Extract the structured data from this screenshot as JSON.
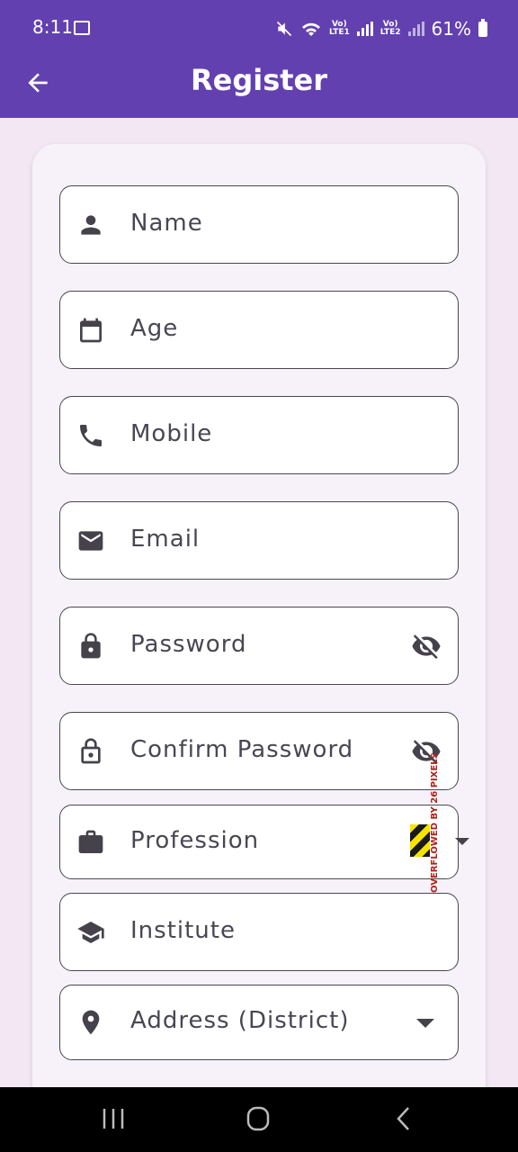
{
  "status_bar": {
    "time": "8:11",
    "network_1": "Vo)\nLTE1",
    "network_2": "Vo)\nLTE2",
    "battery_percent": "61%"
  },
  "app_bar": {
    "title": "Register"
  },
  "form": {
    "fields": [
      {
        "label": "Name",
        "icon": "person-icon"
      },
      {
        "label": "Age",
        "icon": "calendar-icon"
      },
      {
        "label": "Mobile",
        "icon": "phone-icon"
      },
      {
        "label": "Email",
        "icon": "email-icon"
      },
      {
        "label": "Password",
        "icon": "lock-icon",
        "trailing": "visibility-off-icon"
      },
      {
        "label": "Confirm Password",
        "icon": "lock-open-icon",
        "trailing": "visibility-off-icon"
      },
      {
        "label": "Profession",
        "icon": "briefcase-icon",
        "trailing": "dropdown-arrow-icon"
      },
      {
        "label": "Institute",
        "icon": "school-icon"
      },
      {
        "label": "Address (District)",
        "icon": "location-pin-icon",
        "trailing": "dropdown-arrow-icon"
      }
    ],
    "overflow_warning": "OVERFLOWED BY 26 PIXELS"
  },
  "colors": {
    "primary": "#6340b0",
    "background": "#f2e7f3",
    "card": "#f7f2f9",
    "field_border": "#4a4652",
    "text": "#4a4652"
  }
}
